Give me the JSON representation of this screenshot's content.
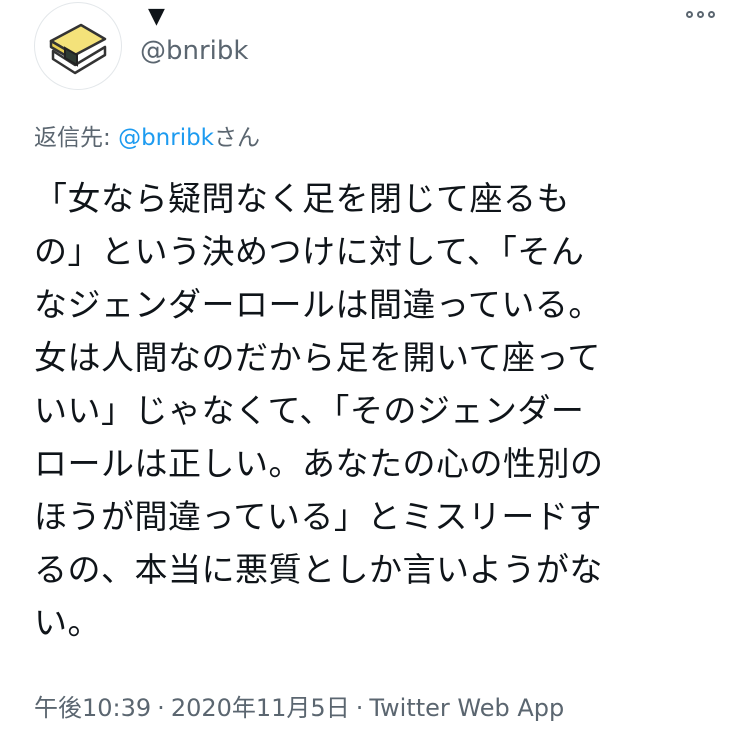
{
  "author": {
    "display_name_marker": "▼",
    "handle": "@bnribk",
    "avatar_icon": "sushi-icon"
  },
  "reply": {
    "prefix": "返信先: ",
    "mention": "@bnribk",
    "suffix": "さん"
  },
  "tweet": {
    "text": "「女なら疑問なく足を閉じて座るも\nの」という決めつけに対して、「そん\nなジェンダーロールは間違っている。\n女は人間なのだから足を開いて座って\nいい」じゃなくて、「そのジェンダー\nロールは正しい。あなたの心の性別の\nほうが間違っている」とミスリードす\nるの、本当に悪質としか言いようがな\nい。"
  },
  "meta": {
    "time": "午後10:39",
    "date": "2020年11月5日",
    "source": "Twitter Web App",
    "separator": "·"
  },
  "colors": {
    "text": "#0f1419",
    "secondary": "#5b6670",
    "link": "#1d9bf0"
  }
}
